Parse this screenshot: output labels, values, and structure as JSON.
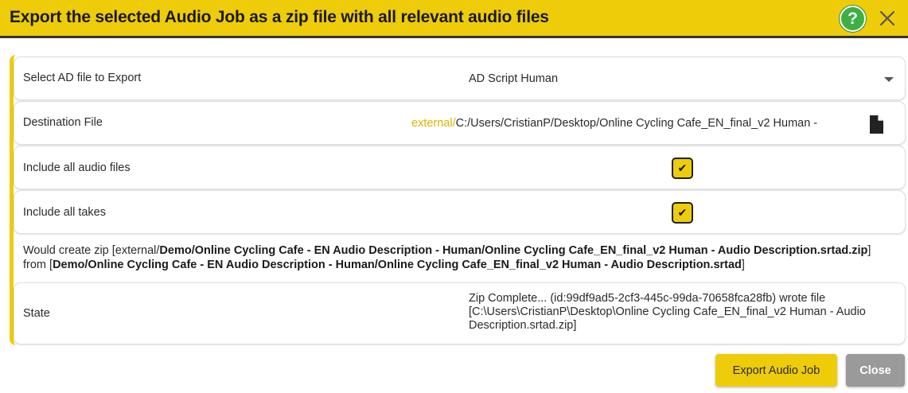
{
  "dialog": {
    "title": "Export the selected Audio Job as a zip file with all relevant audio files",
    "accent_color": "#eecc0a",
    "help_label": "?"
  },
  "rows": {
    "select_file": {
      "label": "Select AD file to Export",
      "value": "AD Script Human"
    },
    "destination": {
      "label": "Destination File",
      "prefix": "external/",
      "path": "C:/Users/CristianP/Desktop/Online Cycling Cafe_EN_final_v2 Human -"
    },
    "include_audio": {
      "label": "Include all audio files",
      "checked": true,
      "check_glyph": "✔"
    },
    "include_takes": {
      "label": "Include all takes",
      "checked": true,
      "check_glyph": "✔"
    }
  },
  "info": {
    "line1_prefix": "Would create zip [external/",
    "line1_bold": "Demo/Online Cycling Cafe - EN Audio Description - Human/Online Cycling Cafe_EN_final_v2 Human - Audio Description.srtad.zip",
    "line1_suffix": "]",
    "line2_prefix": "from [",
    "line2_bold": "Demo/Online Cycling Cafe - EN Audio Description - Human/Online Cycling Cafe_EN_final_v2 Human - Audio Description.srtad",
    "line2_suffix": "]"
  },
  "state": {
    "label": "State",
    "value": "Zip Complete... (id:99df9ad5-2cf3-445c-99da-70658fca28fb) wrote file [C:\\Users\\CristianP\\Desktop\\Online Cycling Cafe_EN_final_v2 Human - Audio Description.srtad.zip]"
  },
  "buttons": {
    "export_label": "Export Audio Job",
    "close_label": "Close"
  }
}
